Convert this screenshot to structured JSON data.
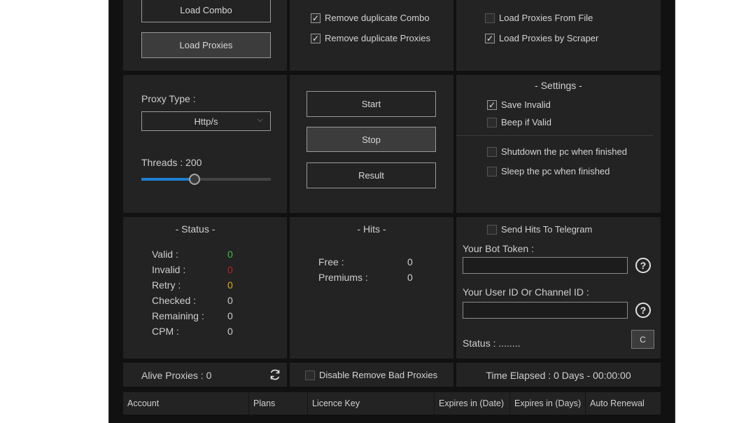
{
  "top_buttons": {
    "load_combo": "Load Combo",
    "load_proxies": "Load Proxies"
  },
  "top_options": [
    {
      "label": "Remove duplicate Combo",
      "checked": true
    },
    {
      "label": "Remove duplicate Proxies",
      "checked": true
    }
  ],
  "proxy_source": [
    {
      "label": "Load Proxies From File",
      "checked": false
    },
    {
      "label": "Load Proxies by Scraper",
      "checked": true
    }
  ],
  "proxy_type": {
    "label": "Proxy Type :",
    "value": "Http/s"
  },
  "threads": {
    "label": "Threads : 200",
    "value": 200,
    "fill_fraction": 0.41
  },
  "controls": {
    "start": "Start",
    "stop": "Stop",
    "result": "Result"
  },
  "settings": {
    "title": "-  Settings  -",
    "options": [
      {
        "label": "Save Invalid",
        "checked": true
      },
      {
        "label": "Beep if Valid",
        "checked": false
      },
      {
        "label": "Shutdown the pc when finished",
        "checked": false
      },
      {
        "label": "Sleep the pc when finished",
        "checked": false
      }
    ]
  },
  "status": {
    "title": "-  Status  -",
    "rows": [
      {
        "label": "Valid :",
        "value": "0",
        "color": "#3fbf3f"
      },
      {
        "label": "Invalid :",
        "value": "0",
        "color": "#c02020"
      },
      {
        "label": "Retry :",
        "value": "0",
        "color": "#e0b000"
      },
      {
        "label": "Checked :",
        "value": "0",
        "color": "#cfcfcf"
      },
      {
        "label": "Remaining :",
        "value": "0",
        "color": "#cfcfcf"
      },
      {
        "label": "CPM :",
        "value": "0",
        "color": "#cfcfcf"
      }
    ]
  },
  "hits": {
    "title": "-  Hits  -",
    "rows": [
      {
        "label": "Free :",
        "value": "0"
      },
      {
        "label": "Premiums :",
        "value": "0"
      }
    ]
  },
  "telegram": {
    "send_hits": "Send Hits To Telegram",
    "send_hits_checked": false,
    "bot_token_label": "Your Bot Token :",
    "bot_token_value": "",
    "user_id_label": "Your User ID Or Channel ID :",
    "user_id_value": "",
    "help": "?",
    "status": "Status : ........",
    "clear_button": "C"
  },
  "bottom_bar": {
    "alive_proxies": "Alive Proxies : 0",
    "disable_remove": "Disable Remove Bad Proxies",
    "disable_remove_checked": false,
    "time_elapsed": "Time Elapsed : 0 Days - 00:00:00"
  },
  "table": {
    "columns": [
      "Account",
      "Plans",
      "Licence Key",
      "Expires in (Date)",
      "Expires in (Days)",
      "Auto Renewal"
    ]
  }
}
